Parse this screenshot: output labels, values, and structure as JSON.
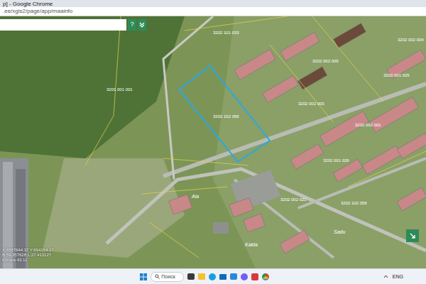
{
  "window": {
    "title": "p] - Google Chrome"
  },
  "address_bar": {
    "url": ".ee/xgis2/page/app/maainfo"
  },
  "map_toolbar": {
    "search_value": "",
    "help_button": "?"
  },
  "map": {
    "selected_parcel": "3202 102 056",
    "parcel_labels": [
      "3202 101 033",
      "3202 002 009",
      "3202 002 001",
      "3202 001 026",
      "3202 001 025",
      "3202 002 021",
      "3201 001 001",
      "3202 002 003",
      "3202 002 004",
      "3202 102 059"
    ],
    "street_labels": [
      "Aia",
      "Kalda",
      "Sadu"
    ]
  },
  "coordinates": [
    "X:6587644.37 Y:694154.17",
    "B:59.357628 L:27.413127",
    "Kõrgus:43.11"
  ],
  "taskbar": {
    "search_placeholder": "Поиск",
    "language": "ENG"
  }
}
